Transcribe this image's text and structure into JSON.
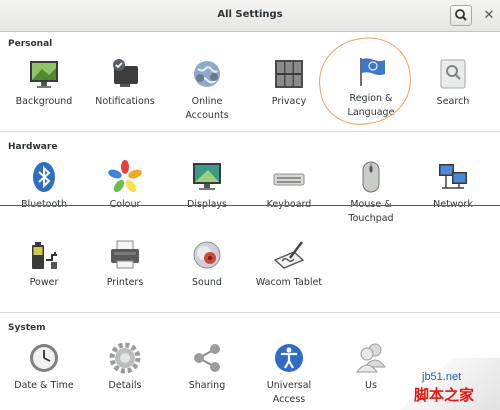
{
  "window": {
    "title": "All Settings",
    "close_glyph": "✕"
  },
  "sections": {
    "personal": {
      "title": "Personal",
      "items": [
        {
          "label": "Background"
        },
        {
          "label": "Notifications"
        },
        {
          "label": "Online\nAccounts"
        },
        {
          "label": "Privacy"
        },
        {
          "label": "Region &\nLanguage"
        },
        {
          "label": "Search"
        }
      ]
    },
    "hardware": {
      "title": "Hardware",
      "items": [
        {
          "label": "Bluetooth"
        },
        {
          "label": "Colour"
        },
        {
          "label": "Displays"
        },
        {
          "label": "Keyboard"
        },
        {
          "label": "Mouse &\nTouchpad"
        },
        {
          "label": "Network"
        },
        {
          "label": "Power"
        },
        {
          "label": "Printers"
        },
        {
          "label": "Sound"
        },
        {
          "label": "Wacom Tablet"
        }
      ]
    },
    "system": {
      "title": "System",
      "items": [
        {
          "label": "Date & Time"
        },
        {
          "label": "Details"
        },
        {
          "label": "Sharing"
        },
        {
          "label": "Universal\nAccess"
        },
        {
          "label": "Us"
        }
      ]
    }
  },
  "watermark": {
    "domain": "jb51.net",
    "text": "脚本之家"
  },
  "colors": {
    "annotation_circle": "#f0a060",
    "annotation_line": "#d8262b",
    "accent_blue": "#3b78c9"
  }
}
